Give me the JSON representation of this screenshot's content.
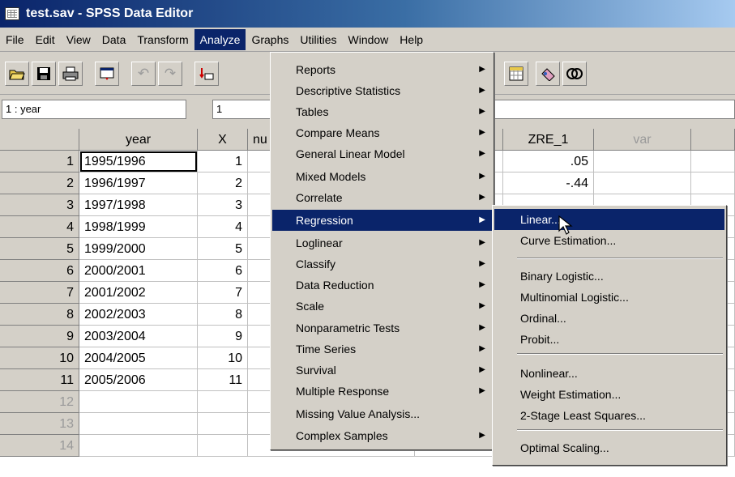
{
  "window": {
    "title": "test.sav - SPSS Data Editor"
  },
  "menubar": [
    "File",
    "Edit",
    "View",
    "Data",
    "Transform",
    "Analyze",
    "Graphs",
    "Utilities",
    "Window",
    "Help"
  ],
  "cell_ref": {
    "name": "1 : year",
    "value": "1"
  },
  "grid": {
    "headers": {
      "year": "year",
      "x": "X",
      "nu": "nu",
      "zre": "ZRE_1",
      "var": "var"
    },
    "rows": [
      {
        "n": "1",
        "year": "1995/1996",
        "x": "1",
        "zre": ".05"
      },
      {
        "n": "2",
        "year": "1996/1997",
        "x": "2",
        "zre": "-.44"
      },
      {
        "n": "3",
        "year": "1997/1998",
        "x": "3",
        "zre": ""
      },
      {
        "n": "4",
        "year": "1998/1999",
        "x": "4",
        "zre": ""
      },
      {
        "n": "5",
        "year": "1999/2000",
        "x": "5",
        "zre": ""
      },
      {
        "n": "6",
        "year": "2000/2001",
        "x": "6",
        "zre": ""
      },
      {
        "n": "7",
        "year": "2001/2002",
        "x": "7",
        "zre": ""
      },
      {
        "n": "8",
        "year": "2002/2003",
        "x": "8",
        "zre": ""
      },
      {
        "n": "9",
        "year": "2003/2004",
        "x": "9",
        "zre": ""
      },
      {
        "n": "10",
        "year": "2004/2005",
        "x": "10",
        "zre": ""
      },
      {
        "n": "11",
        "year": "2005/2006",
        "x": "11",
        "zre": ""
      },
      {
        "n": "12",
        "year": "",
        "x": "",
        "zre": ""
      },
      {
        "n": "13",
        "year": "",
        "x": "",
        "zre": ""
      },
      {
        "n": "14",
        "year": "",
        "x": "",
        "zre": ""
      }
    ]
  },
  "analyze_menu": [
    "Reports",
    "Descriptive Statistics",
    "Tables",
    "Compare Means",
    "General Linear Model",
    "Mixed Models",
    "Correlate",
    "Regression",
    "Loglinear",
    "Classify",
    "Data Reduction",
    "Scale",
    "Nonparametric Tests",
    "Time Series",
    "Survival",
    "Multiple Response",
    "Missing Value Analysis...",
    "Complex Samples"
  ],
  "regression_menu": [
    "Linear...",
    "Curve Estimation...",
    "Binary Logistic...",
    "Multinomial Logistic...",
    "Ordinal...",
    "Probit...",
    "Nonlinear...",
    "Weight Estimation...",
    "2-Stage Least Squares...",
    "Optimal Scaling..."
  ],
  "colors": {
    "menu_highlight": "#0a246a",
    "title_gradient_start": "#0a246a",
    "face": "#d4d0c8"
  }
}
